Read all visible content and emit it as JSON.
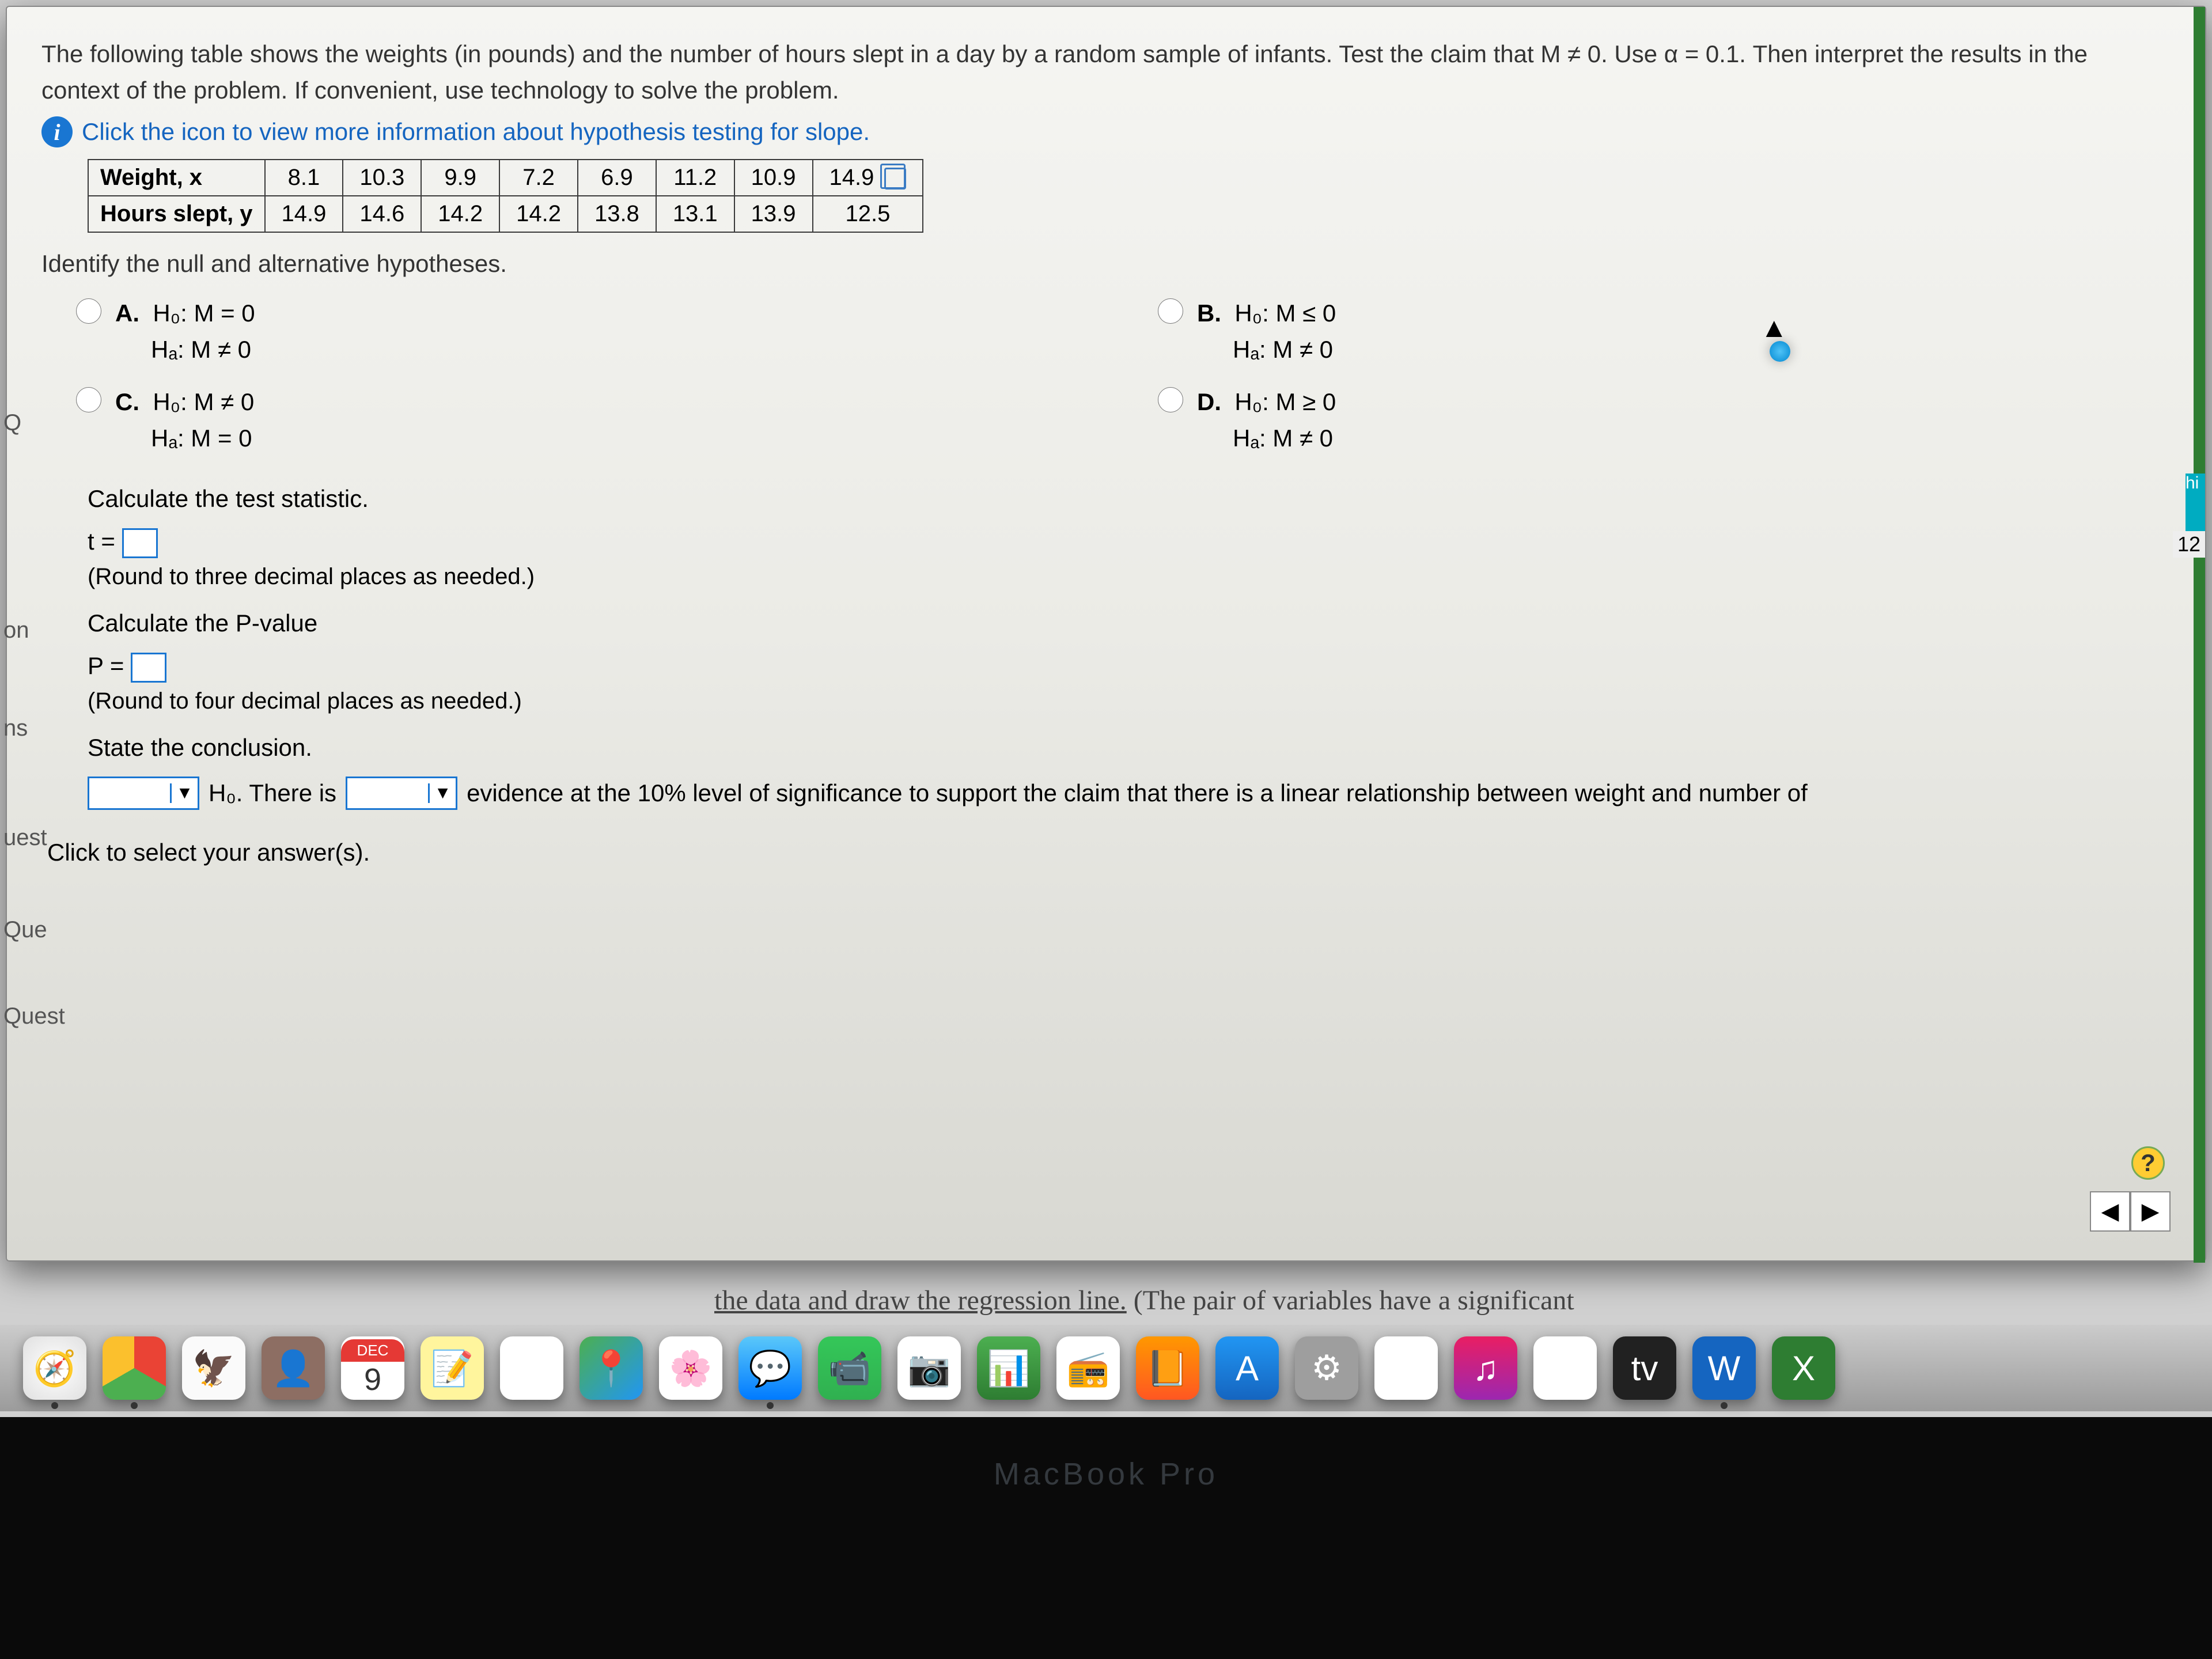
{
  "problem": {
    "p1": "The following table shows the weights (in pounds) and the number of hours slept in a day by a random sample of infants. Test the claim that M ≠ 0. Use α = 0.1. Then interpret the results in the context of the problem. If convenient, use technology to solve the problem.",
    "info_link": "Click the icon to view more information about hypothesis testing for slope."
  },
  "table": {
    "row1_label": "Weight, x",
    "row2_label": "Hours slept, y",
    "weights": [
      "8.1",
      "10.3",
      "9.9",
      "7.2",
      "6.9",
      "11.2",
      "10.9",
      "14.9"
    ],
    "hours": [
      "14.9",
      "14.6",
      "14.2",
      "14.2",
      "13.8",
      "13.1",
      "13.9",
      "12.5"
    ]
  },
  "identify": "Identify the null and alternative hypotheses.",
  "options": {
    "A": {
      "label": "A.",
      "h0": "H₀: M = 0",
      "ha": "Hₐ: M ≠ 0"
    },
    "B": {
      "label": "B.",
      "h0": "H₀: M ≤ 0",
      "ha": "Hₐ: M ≠ 0"
    },
    "C": {
      "label": "C.",
      "h0": "H₀: M ≠ 0",
      "ha": "Hₐ: M = 0"
    },
    "D": {
      "label": "D.",
      "h0": "H₀: M ≥ 0",
      "ha": "Hₐ: M ≠ 0"
    }
  },
  "test_stat": {
    "label": "Calculate the test statistic.",
    "eq": "t =",
    "hint": "(Round to three decimal places as needed.)"
  },
  "pvalue": {
    "label": "Calculate the P-value",
    "eq": "P =",
    "hint": "(Round to four decimal places as needed.)"
  },
  "conclusion": {
    "label": "State the conclusion.",
    "mid1": "H₀. There is",
    "mid2": "evidence at the 10% level of significance to support the claim that there is a linear relationship between weight and number of"
  },
  "click_prompt": "Click to select your answer(s).",
  "bg_text1": "the data and draw the regression line.",
  "bg_text2": " (The pair of variables have a significant",
  "left_tabs": {
    "q": "Q",
    "on": "on",
    "ns": "ns",
    "uest": "uest",
    "que": "Que",
    "quest": "Quest"
  },
  "right": {
    "hi": "hi",
    "n12": "12"
  },
  "help": "?",
  "nav": {
    "prev": "◀",
    "next": "▶"
  },
  "dock": {
    "cal_month": "DEC",
    "cal_day": "9",
    "tv": "tv",
    "word": "W",
    "excel": "X",
    "appstore": "A",
    "itunes": "♫"
  },
  "mbp": "MacBook Pro"
}
